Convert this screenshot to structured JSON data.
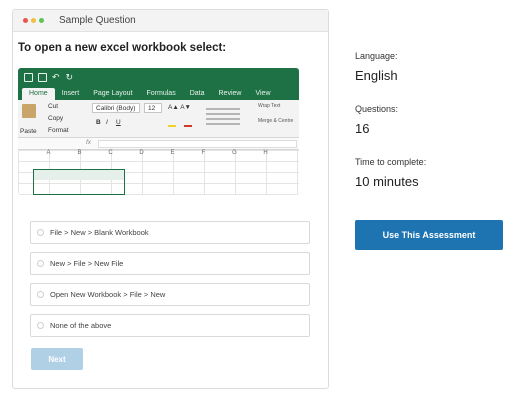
{
  "card": {
    "title": "Sample Question",
    "window_dot_colors": [
      "#e8554e",
      "#f2bf42",
      "#5fc454"
    ]
  },
  "question": {
    "text": "To open a new excel workbook select:",
    "image": {
      "ribbon_color": "#1e7145",
      "tabs": [
        "Home",
        "Insert",
        "Page Layout",
        "Formulas",
        "Data",
        "Review",
        "View"
      ],
      "active_tab": "Home",
      "tools": {
        "cut": "Cut",
        "copy": "Copy",
        "format": "Format",
        "paste": "Paste",
        "font": "Calibri (Body)",
        "size": "12",
        "bold": "B",
        "italic": "I",
        "underline": "U",
        "wrap": "Wrap Text",
        "merge": "Merge & Centre"
      },
      "formula_symbol": "fx",
      "columns": [
        "A",
        "B",
        "C",
        "D",
        "E",
        "F",
        "G",
        "H",
        "I"
      ]
    },
    "options": [
      "File > New > Blank Workbook",
      "New > File > New File",
      "Open New Workbook > File > New",
      "None of the above"
    ],
    "next_label": "Next"
  },
  "assessment": {
    "language_label": "Language:",
    "language_value": "English",
    "questions_label": "Questions:",
    "questions_value": "16",
    "time_label": "Time to complete:",
    "time_value": "10 minutes",
    "use_label": "Use This Assessment",
    "accent_color": "#1d74b0"
  }
}
